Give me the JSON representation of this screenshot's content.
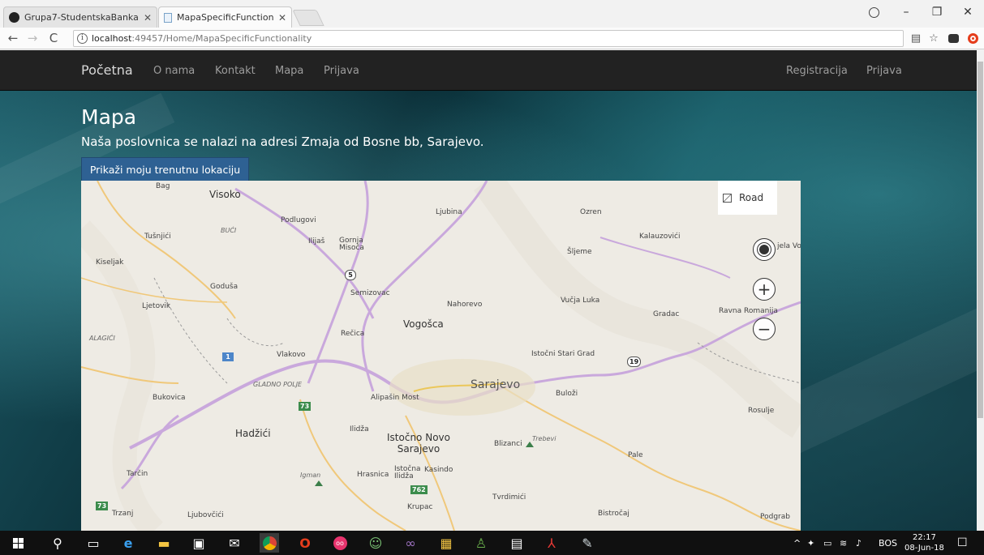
{
  "browser": {
    "tabs": [
      {
        "title": "Grupa7-StudentskaBanka",
        "icon": "github-icon",
        "active": false
      },
      {
        "title": "MapaSpecificFunctionalit",
        "icon": "page-icon",
        "active": true
      }
    ],
    "url_host": "localhost",
    "url_rest": ":49457/Home/MapaSpecificFunctionality"
  },
  "navbar": {
    "brand": "Početna",
    "links": [
      "O nama",
      "Kontakt",
      "Mapa",
      "Prijava"
    ],
    "right_links": [
      "Registracija",
      "Prijava"
    ]
  },
  "main": {
    "title": "Mapa",
    "subtitle": "Naša poslovnica se nalazi na adresi Zmaja od Bosne bb, Sarajevo.",
    "location_button": "Prikaži moju trenutnu lokaciju"
  },
  "map": {
    "type_label": "Road",
    "places": {
      "bag": "Bag",
      "visoko": "Visoko",
      "ljubina": "Ljubina",
      "ozren": "Ozren",
      "podlugovi": "Podlugovi",
      "buci": "BUĆI",
      "tusnjici": "Tušnjići",
      "ilijas": "Ilijaš",
      "gornja_misoca": "Gornja Misoča",
      "kalauzovici": "Kalauzovići",
      "sljeme": "Šljeme",
      "kiseljak": "Kiseljak",
      "godusa": "Goduša",
      "semizovac": "Semizovac",
      "nahorevo": "Nahorevo",
      "vucja_luka": "Vučja Luka",
      "gradac": "Gradac",
      "ravna_romanija": "Ravna Romanija",
      "ljetovik": "Ljetovik",
      "alagici": "ALAGIĆI",
      "recica": "Rečica",
      "vogosca": "Vogošca",
      "vlakovo": "Vlakovo",
      "istocni_stari_grad": "Istočni Stari Grad",
      "gladno_polje": "GLADNO POLJE",
      "sarajevo": "Sarajevo",
      "bukovica": "Bukovica",
      "alipasin_most": "Alipašin Most",
      "buloz": "Buloži",
      "rosulje": "Rosulje",
      "hadzici": "Hadžići",
      "ilidza": "Ilidža",
      "istocno_novo_sarajevo": "Istočno Novo Sarajevo",
      "bizanci": "Blizanci",
      "trebevi": "Trebevi",
      "pale": "Pale",
      "tarcin": "Tarčin",
      "igman": "Igman",
      "hrasnica": "Hrasnica",
      "istocna_ilidza": "Istočna Ilidža",
      "kasindo": "Kasindo",
      "tvrdimici": "Tvrdimići",
      "trzanj": "Trzanj",
      "ljubovcici": "Ljubovčići",
      "krupac": "Krupac",
      "bistrocaj": "Bistročaj",
      "podgrab": "Podgrab",
      "jela_vo": "jela Vo"
    },
    "shields": {
      "r5": "5",
      "r1": "1",
      "r73a": "73",
      "r73b": "73",
      "r19": "19",
      "r762": "762"
    },
    "controls": {
      "locate": "locate-icon",
      "zoom_in": "+",
      "zoom_out": "−"
    }
  },
  "taskbar": {
    "lang": "BOS",
    "time": "22:17",
    "date": "08-Jun-18"
  },
  "colors": {
    "navbar": "#222222",
    "button": "#2e6193",
    "map_road_major": "#c9a8dc",
    "map_road_minor": "#f3c97a"
  }
}
